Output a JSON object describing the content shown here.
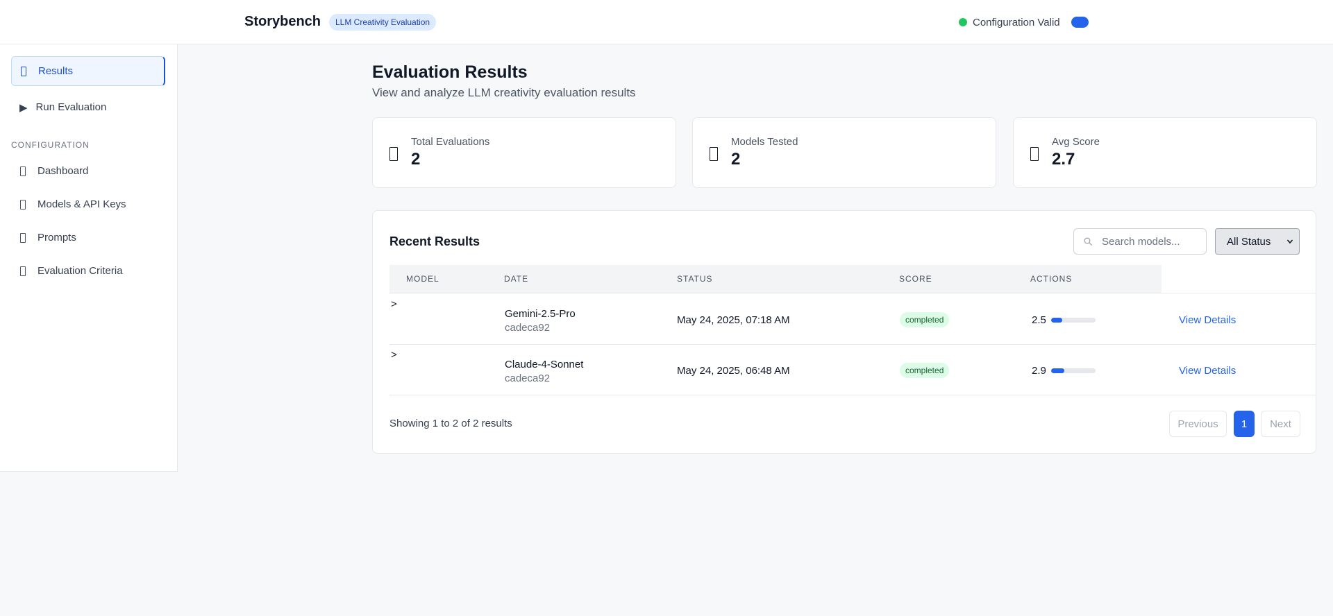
{
  "header": {
    "brand": "Storybench",
    "badge": "LLM Creativity Evaluation",
    "config_status": "Configuration Valid"
  },
  "sidebar": {
    "items": [
      {
        "label": "Results",
        "icon": "document-icon",
        "active": true
      },
      {
        "label": "Run Evaluation",
        "icon": "play-icon",
        "active": false
      }
    ],
    "section_label": "CONFIGURATION",
    "config_items": [
      {
        "label": "Dashboard",
        "icon": "dashboard-icon"
      },
      {
        "label": "Models & API Keys",
        "icon": "key-icon"
      },
      {
        "label": "Prompts",
        "icon": "prompt-icon"
      },
      {
        "label": "Evaluation Criteria",
        "icon": "criteria-icon"
      }
    ]
  },
  "main": {
    "title": "Evaluation Results",
    "subtitle": "View and analyze LLM creativity evaluation results",
    "stats": [
      {
        "label": "Total Evaluations",
        "value": "2",
        "icon": "evaluations-icon"
      },
      {
        "label": "Models Tested",
        "value": "2",
        "icon": "models-icon"
      },
      {
        "label": "Avg Score",
        "value": "2.7",
        "icon": "score-icon"
      }
    ]
  },
  "results": {
    "title": "Recent Results",
    "search_placeholder": "Search models...",
    "status_filter": "All Status",
    "columns": [
      "MODEL",
      "DATE",
      "STATUS",
      "SCORE",
      "ACTIONS"
    ],
    "rows": [
      {
        "expander": ">",
        "model": "Gemini-2.5-Pro",
        "sub": "cadeca92",
        "date": "May 24, 2025, 07:18 AM",
        "status": "completed",
        "score": "2.5",
        "score_fraction": 0.25,
        "action": "View Details"
      },
      {
        "expander": ">",
        "model": "Claude-4-Sonnet",
        "sub": "cadeca92",
        "date": "May 24, 2025, 06:48 AM",
        "status": "completed",
        "score": "2.9",
        "score_fraction": 0.29,
        "action": "View Details"
      }
    ],
    "showing": "Showing 1 to 2 of 2 results",
    "pagination": {
      "previous": "Previous",
      "current": "1",
      "next": "Next"
    }
  },
  "colors": {
    "accent": "#2563eb",
    "status_ok": "#22c55e",
    "badge_bg": "#dcfce7",
    "badge_text": "#166534"
  }
}
